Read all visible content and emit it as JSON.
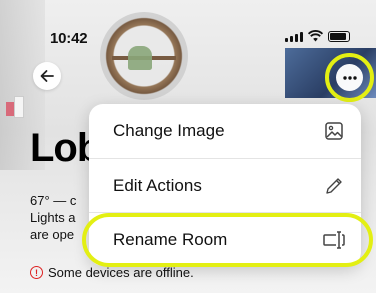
{
  "status_bar": {
    "time": "10:42"
  },
  "room": {
    "title": "Lob",
    "info_line1": "67° — c",
    "info_line2": "Lights a",
    "info_line3": "are ope",
    "warning": "Some devices are offline."
  },
  "menu": {
    "items": [
      {
        "label": "Change Image",
        "icon": "image-icon"
      },
      {
        "label": "Edit Actions",
        "icon": "pencil-icon"
      },
      {
        "label": "Rename Room",
        "icon": "text-cursor-icon"
      }
    ]
  },
  "colors": {
    "highlight": "#e3ef13",
    "warning": "#dd2222"
  }
}
